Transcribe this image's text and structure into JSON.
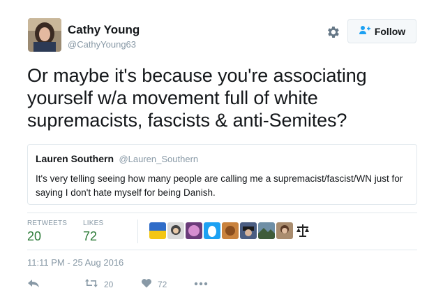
{
  "author": {
    "name": "Cathy Young",
    "handle": "@CathyYoung63"
  },
  "header": {
    "follow_label": "Follow"
  },
  "tweet": {
    "text": "Or maybe it's because you're associating yourself w/a movement full of white supremacists, fascists & anti-Semites?"
  },
  "quote": {
    "name": "Lauren Southern",
    "handle": "@Lauren_Southern",
    "text": "It's very telling seeing how many people are calling me a supremacist/fascist/WN just for saying I don't hate myself for being Danish."
  },
  "stats": {
    "retweets_label": "RETWEETS",
    "retweets_value": "20",
    "likes_label": "LIKES",
    "likes_value": "72"
  },
  "timestamp": "11:11 PM - 25 Aug 2016",
  "actions": {
    "retweet_count": "20",
    "like_count": "72"
  },
  "colors": {
    "accent": "#1da1f2",
    "stat_green": "#2b7a37",
    "muted": "#8899a6",
    "border": "#e1e8ed"
  }
}
